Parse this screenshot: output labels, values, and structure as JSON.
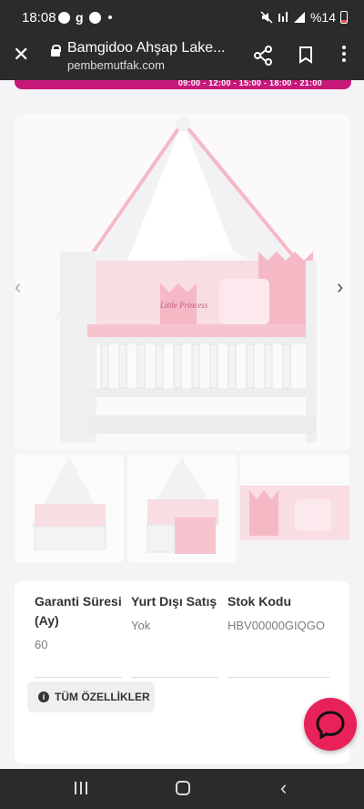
{
  "status_bar": {
    "time": "18:08",
    "battery": "%14",
    "icons": [
      "facebook-icon",
      "g-icon",
      "camera-icon",
      "mute-icon",
      "wifi-icon",
      "signal-icon",
      "battery-icon"
    ]
  },
  "url_bar": {
    "title": "Bamgidoo Ahşap Lake...",
    "host": "pembemutfak.com"
  },
  "banner": {
    "times": "09:00 - 12:00 - 15:00 - 18:00 - 21:00",
    "color": "#c7197a"
  },
  "product_image": {
    "pillow_text": "Little Princess"
  },
  "specs": [
    {
      "label": "Garanti Süresi (Ay)",
      "value": "60"
    },
    {
      "label": "Yurt Dışı Satış",
      "value": "Yok"
    },
    {
      "label": "Stok Kodu",
      "value": "HBV00000GIQGO"
    }
  ],
  "all_features_button": "TÜM ÖZELLİKLER",
  "colors": {
    "accent": "#e8215a",
    "pink": "#f6c3cf",
    "chrome": "#2b2b2e"
  }
}
